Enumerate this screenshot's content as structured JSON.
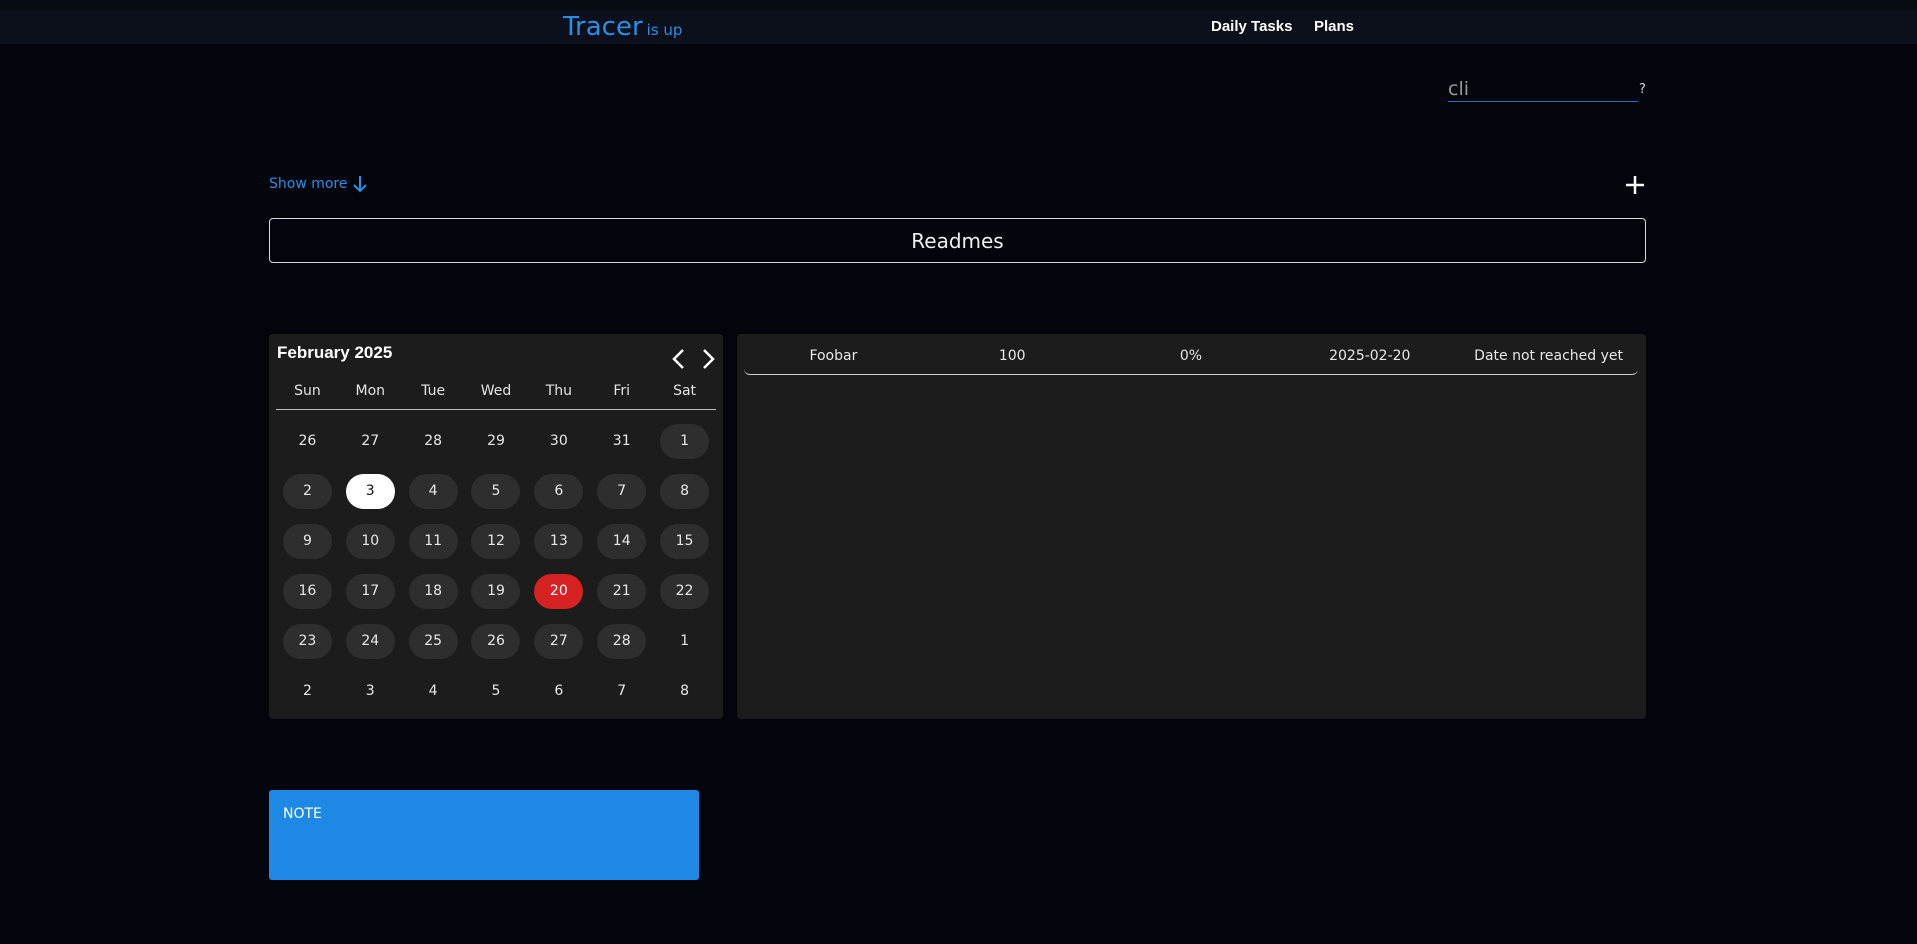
{
  "header": {
    "brand": "Tracer",
    "status": "is up",
    "nav": [
      {
        "label": "Daily Tasks"
      },
      {
        "label": "Plans"
      }
    ]
  },
  "cli": {
    "value": "cli",
    "help": "?"
  },
  "show_more": {
    "label": "Show more",
    "icon": "arrow-down-icon"
  },
  "add_icon": "plus-icon",
  "readmes": {
    "label": "Readmes"
  },
  "calendar": {
    "title": "February 2025",
    "weekdays": [
      "Sun",
      "Mon",
      "Tue",
      "Wed",
      "Thu",
      "Fri",
      "Sat"
    ],
    "days": [
      "26",
      "27",
      "28",
      "29",
      "30",
      "31",
      "1",
      "2",
      "3",
      "4",
      "5",
      "6",
      "7",
      "8",
      "9",
      "10",
      "11",
      "12",
      "13",
      "14",
      "15",
      "16",
      "17",
      "18",
      "19",
      "20",
      "21",
      "22",
      "23",
      "24",
      "25",
      "26",
      "27",
      "28",
      "1",
      "2",
      "3",
      "4",
      "5",
      "6",
      "7",
      "8"
    ],
    "selected": "3",
    "deadline": "20",
    "colors": {
      "selected": "#ffffff",
      "deadline": "#d62222",
      "current_month_day": "#2e2e2e"
    }
  },
  "tasks": [
    {
      "name": "Foobar",
      "value": "100",
      "progress": "0%",
      "date": "2025-02-20",
      "status": "Date not reached yet"
    }
  ],
  "note": {
    "label": "NOTE"
  },
  "colors": {
    "accent": "#2b8ee8",
    "background": "#02060c",
    "note": "#1e88e5"
  }
}
